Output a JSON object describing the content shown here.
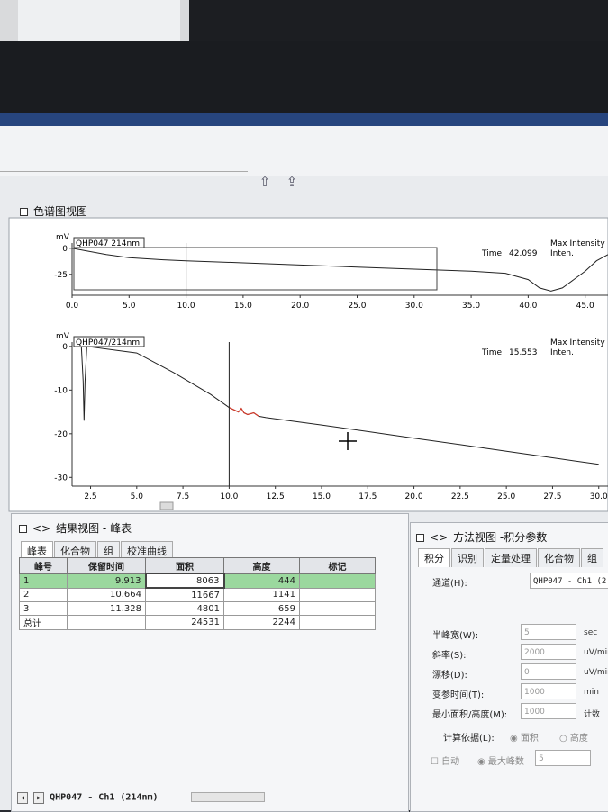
{
  "panels": {
    "chromatogram_title": "色谱图视图",
    "results_title": "结果视图 -  峰表",
    "method_title": "方法视图 -积分参数"
  },
  "top_chart": {
    "yunit": "mV",
    "trace_label": "QHP047 214nm",
    "yticks": [
      "0",
      "-25"
    ],
    "xticks": [
      "0.0",
      "5.0",
      "10.0",
      "15.0",
      "20.0",
      "25.0",
      "30.0",
      "35.0",
      "40.0",
      "45.0"
    ],
    "time_label": "Time",
    "time_value": "42.099",
    "max_intensity": "Max Intensity",
    "inten": "Inten."
  },
  "bottom_chart": {
    "yunit": "mV",
    "trace_label": "QHP047/214nm",
    "yticks": [
      "0",
      "-10",
      "-20",
      "-30"
    ],
    "xticks": [
      "2.5",
      "5.0",
      "7.5",
      "10.0",
      "12.5",
      "15.0",
      "17.5",
      "20.0",
      "22.5",
      "25.0",
      "27.5",
      "30.0"
    ],
    "time_label": "Time",
    "time_value": "15.553",
    "max_intensity": "Max Intensity",
    "inten": "Inten."
  },
  "chart_data": [
    {
      "type": "line",
      "title": "",
      "xlabel": "",
      "ylabel": "mV",
      "xlim": [
        0,
        47
      ],
      "ylim": [
        -45,
        5
      ],
      "series": [
        {
          "x": [
            0,
            1,
            3,
            5,
            8,
            10,
            15,
            20,
            25,
            30,
            35,
            38,
            40,
            41,
            42,
            43,
            44,
            45,
            46,
            47
          ],
          "y": [
            0,
            -2,
            -6,
            -9,
            -11,
            -12,
            -14,
            -16,
            -18,
            -20,
            -22,
            -24,
            -30,
            -38,
            -41,
            -38,
            -30,
            -22,
            -12,
            -6
          ]
        }
      ]
    },
    {
      "type": "line",
      "title": "",
      "xlabel": "",
      "ylabel": "mV",
      "xlim": [
        1.5,
        30.5
      ],
      "ylim": [
        -32,
        1
      ],
      "series": [
        {
          "x": [
            2.0,
            2.1,
            2.15,
            2.2,
            2.3,
            5.0,
            7.0,
            9.0,
            10.0,
            10.5,
            10.66,
            10.8,
            11.0,
            11.33,
            11.6,
            12.0,
            15.0,
            17.5,
            20.0,
            22.5,
            25.0,
            27.5,
            30.0
          ],
          "y": [
            0,
            -8,
            -17,
            -8,
            0,
            -1.5,
            -6,
            -11,
            -14,
            -15,
            -14.2,
            -15.2,
            -15.6,
            -15.2,
            -16,
            -16.3,
            -18,
            -19.5,
            -21,
            -22.5,
            -24,
            -25.5,
            -27
          ]
        }
      ]
    }
  ],
  "results": {
    "tabs": [
      "峰表",
      "化合物",
      "组",
      "校准曲线"
    ],
    "columns": [
      "峰号",
      "保留时间",
      "面积",
      "高度",
      "标记"
    ],
    "rows": [
      {
        "no": "1",
        "rt": "9.913",
        "area": "8063",
        "height": "444",
        "mark": ""
      },
      {
        "no": "2",
        "rt": "10.664",
        "area": "11667",
        "height": "1141",
        "mark": ""
      },
      {
        "no": "3",
        "rt": "11.328",
        "area": "4801",
        "height": "659",
        "mark": ""
      },
      {
        "no": "总计",
        "rt": "",
        "area": "24531",
        "height": "2244",
        "mark": ""
      }
    ],
    "bottom_tab": "QHP047 - Ch1 (214nm)"
  },
  "method": {
    "tabs": [
      "积分",
      "识别",
      "定量处理",
      "化合物",
      "组"
    ],
    "channel_label": "通道(H):",
    "channel_value": "QHP047 - Ch1 (2",
    "fields": [
      {
        "label": "半峰宽(W):",
        "value": "5",
        "unit": "sec"
      },
      {
        "label": "斜率(S):",
        "value": "2000",
        "unit": "uV/min"
      },
      {
        "label": "漂移(D):",
        "value": "0",
        "unit": "uV/min"
      },
      {
        "label": "变参时间(T):",
        "value": "1000",
        "unit": "min"
      },
      {
        "label": "最小面积/高度(M):",
        "value": "1000",
        "unit": "计数"
      }
    ],
    "calc_label": "计算依据(L):",
    "calc_area": "面积",
    "calc_height": "高度",
    "auto_label": "自动",
    "max_peaks_label": "最大峰数",
    "max_peaks_value": "5"
  },
  "colors": {
    "trace": "#222222",
    "peak": "#d23a2a",
    "highlight": "#9bd89e",
    "screen_bg": "#e9ebee"
  }
}
